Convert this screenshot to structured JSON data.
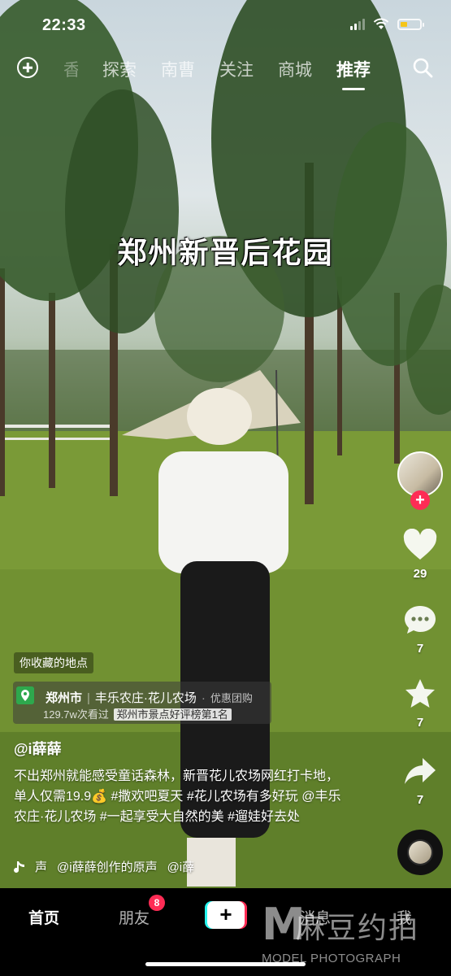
{
  "status": {
    "time": "22:33"
  },
  "topnav": {
    "tabs": [
      {
        "label": "香",
        "state": "faded"
      },
      {
        "label": "探索",
        "state": "normal"
      },
      {
        "label": "南曹",
        "state": "normal"
      },
      {
        "label": "关注",
        "state": "normal"
      },
      {
        "label": "商城",
        "state": "normal"
      },
      {
        "label": "推荐",
        "state": "active"
      }
    ]
  },
  "video": {
    "caption": "郑州新晋后花园"
  },
  "rail": {
    "likes": "29",
    "comments": "7",
    "favorites": "7",
    "shares": "7"
  },
  "info": {
    "saved_tag": "你收藏的地点",
    "poi": {
      "city": "郑州市",
      "name": "丰乐农庄·花儿农场",
      "deal": "优惠团购",
      "views": "129.7w次看过",
      "rank_prefix": "郑州市景点",
      "rank_text": "好评榜第1名"
    },
    "author": "@i薛薛",
    "description": "不出郑州就能感受童话森林，新晋花儿农场网红打卡地，单人仅需19.9💰 #撒欢吧夏天 #花儿农场有多好玩 @丰乐农庄·花儿农场 #一起享受大自然的美 #遛娃好去处",
    "music": {
      "left": "声",
      "middle": "@i薛薛创作的原声",
      "right": "@i薛"
    }
  },
  "tabbar": {
    "home": "首页",
    "friends": "朋友",
    "friends_badge": "8",
    "create": "+",
    "messages": "消息",
    "me": "我"
  },
  "watermark": {
    "main": "麻豆约拍",
    "letter": "M",
    "sub": "MODEL PHOTOGRAPH"
  },
  "colors": {
    "accent": "#fe2c55",
    "cyan": "#25f4ee",
    "poi_green": "#2ea84d"
  }
}
